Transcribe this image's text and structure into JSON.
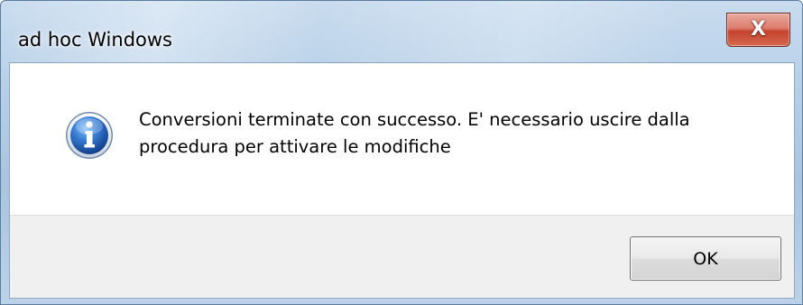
{
  "window": {
    "title": "ad hoc Windows",
    "close_glyph": "X"
  },
  "dialog": {
    "icon": "information-icon",
    "message": "Conversioni terminate con successo. E' necessario uscire dalla procedura per attivare le modifiche",
    "ok_label": "OK"
  },
  "colors": {
    "info_blue": "#1f5bb5",
    "close_red": "#c5432d",
    "button_bar": "#f0f0f0"
  }
}
